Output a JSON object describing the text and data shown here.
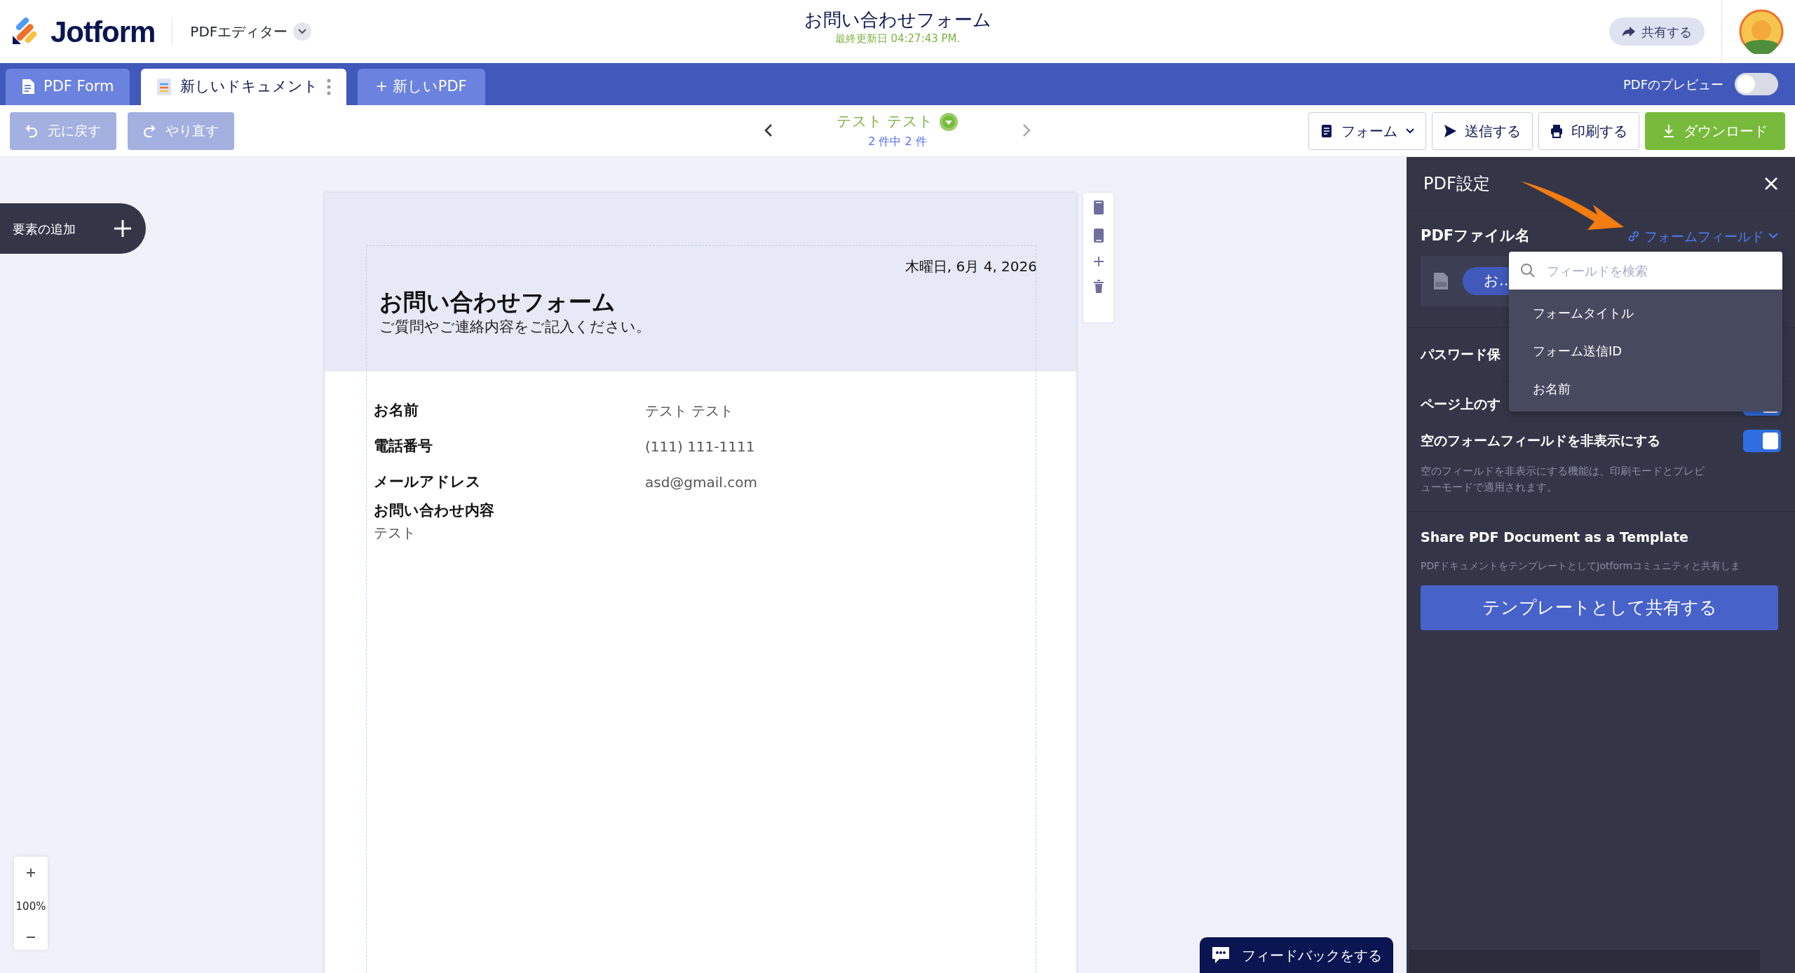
{
  "header": {
    "logo": "Jotform",
    "product": "PDFエディター",
    "title": "お問い合わせフォーム",
    "last_saved": "最終更新日 04:27:43 PM.",
    "share_button": "共有する"
  },
  "tabs": [
    {
      "label": "PDF Form",
      "kind": "form",
      "selected": false
    },
    {
      "label": "新しいドキュメント",
      "kind": "document",
      "selected": true
    },
    {
      "label": "+ 新しいPDF",
      "kind": "add",
      "selected": false
    }
  ],
  "preview": {
    "label": "PDFのプレビュー",
    "on": false
  },
  "toolbar": {
    "undo": {
      "label": "元に戻す",
      "disabled": true
    },
    "redo": {
      "label": "やり直す",
      "disabled": true
    },
    "submission": {
      "name": "テスト テスト",
      "counter": "2 件中 2 件"
    },
    "buttons": [
      {
        "label": "フォーム",
        "kind": "dropdown"
      },
      {
        "label": "送信する",
        "kind": "send"
      },
      {
        "label": "印刷する",
        "kind": "print"
      },
      {
        "label": "ダウンロード",
        "kind": "download"
      }
    ]
  },
  "add_element": "要素の追加",
  "zoom": "100%",
  "document": {
    "date": "木曜日, 6月 4, 2026",
    "title": "お問い合わせフォーム",
    "subtitle": "ご質問やご連絡内容をご記入ください。",
    "fields": [
      {
        "label": "お名前",
        "value": "テスト テスト",
        "kind": "inline"
      },
      {
        "label": "電話番号",
        "value": "(111) 111-1111",
        "kind": "inline"
      },
      {
        "label": "メールアドレス",
        "value": "asd@gmail.com",
        "kind": "inline"
      },
      {
        "label": "お問い合わせ内容",
        "value": "テスト",
        "kind": "stacked"
      }
    ]
  },
  "feedback": "フィードバックをする",
  "settings_panel": {
    "title": "PDF設定",
    "file_name_label": "PDFファイル名",
    "field_link": "フォームフィールド",
    "file_name_chip": "お..",
    "settings": [
      {
        "label": "パスワード保",
        "kind": "row"
      },
      {
        "label": "ページ上のす",
        "kind": "toggle",
        "on": true
      },
      {
        "label": "空のフォームフィールドを非表示にする",
        "kind": "toggle",
        "on": true,
        "note": "空のフィールドを非表示にする機能は、印刷モードとプレビューモードで適用されます。"
      }
    ],
    "share": {
      "title": "Share PDF Document as a Template",
      "description": "PDFドキュメントをテンプレートとしてJotformコミュニティと共有しま",
      "button": "テンプレートとして共有する"
    },
    "dropdown": {
      "placeholder": "フィールドを検索",
      "items": [
        "フォームタイトル",
        "フォーム送信ID",
        "お名前"
      ]
    }
  }
}
